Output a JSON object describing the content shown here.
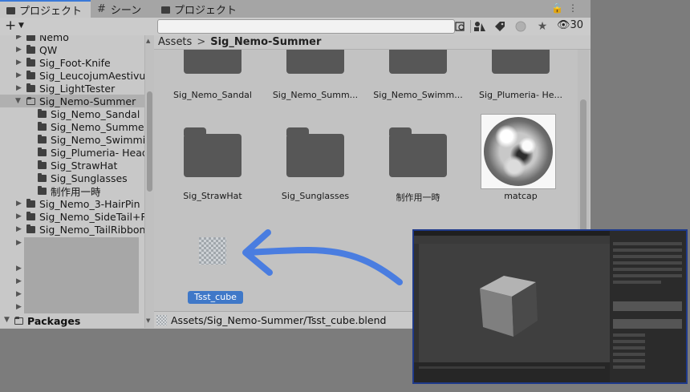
{
  "tabs": [
    {
      "label": "プロジェクト",
      "icon": "folder-icon",
      "active": true
    },
    {
      "label": "シーン",
      "icon": "hash-icon",
      "active": false
    },
    {
      "label": "プロジェクト",
      "icon": "folder-icon",
      "active": false
    }
  ],
  "toolbar": {
    "add_label": "+",
    "hidden_count": "30"
  },
  "tree": {
    "items": [
      {
        "label": "Nemo"
      },
      {
        "label": "QW"
      },
      {
        "label": "Sig_Foot-Knife"
      },
      {
        "label": "Sig_LeucojumAestivum"
      },
      {
        "label": "Sig_LightTester"
      },
      {
        "label": "Sig_Nemo-Summer"
      },
      {
        "label": "Sig_Nemo_Sandal"
      },
      {
        "label": "Sig_Nemo_SummerC"
      },
      {
        "label": "Sig_Nemo_Swimming"
      },
      {
        "label": "Sig_Plumeria- Headl"
      },
      {
        "label": "Sig_StrawHat"
      },
      {
        "label": "Sig_Sunglasses"
      },
      {
        "label": "制作用一時"
      },
      {
        "label": "Sig_Nemo_3-HairPin"
      },
      {
        "label": "Sig_Nemo_SideTail+Ri"
      },
      {
        "label": "Sig_Nemo_TailRibbon"
      }
    ],
    "packages_label": "Packages"
  },
  "breadcrumb": {
    "root": "Assets",
    "separator": ">",
    "current": "Sig_Nemo-Summer"
  },
  "assets": {
    "row1": [
      "Sig_Nemo_Sandal",
      "Sig_Nemo_Summ...",
      "Sig_Nemo_Swimm...",
      "Sig_Plumeria- He..."
    ],
    "row2": [
      "Sig_StrawHat",
      "Sig_Sunglasses",
      "制作用一時",
      "matcap"
    ],
    "selected": "Tsst_cube"
  },
  "status": {
    "path": "Assets/Sig_Nemo-Summer/Tsst_cube.blend"
  },
  "colors": {
    "selection": "#3f78c8",
    "annotation_arrow": "#4a7de0",
    "inset_border": "#1f3a8a"
  }
}
